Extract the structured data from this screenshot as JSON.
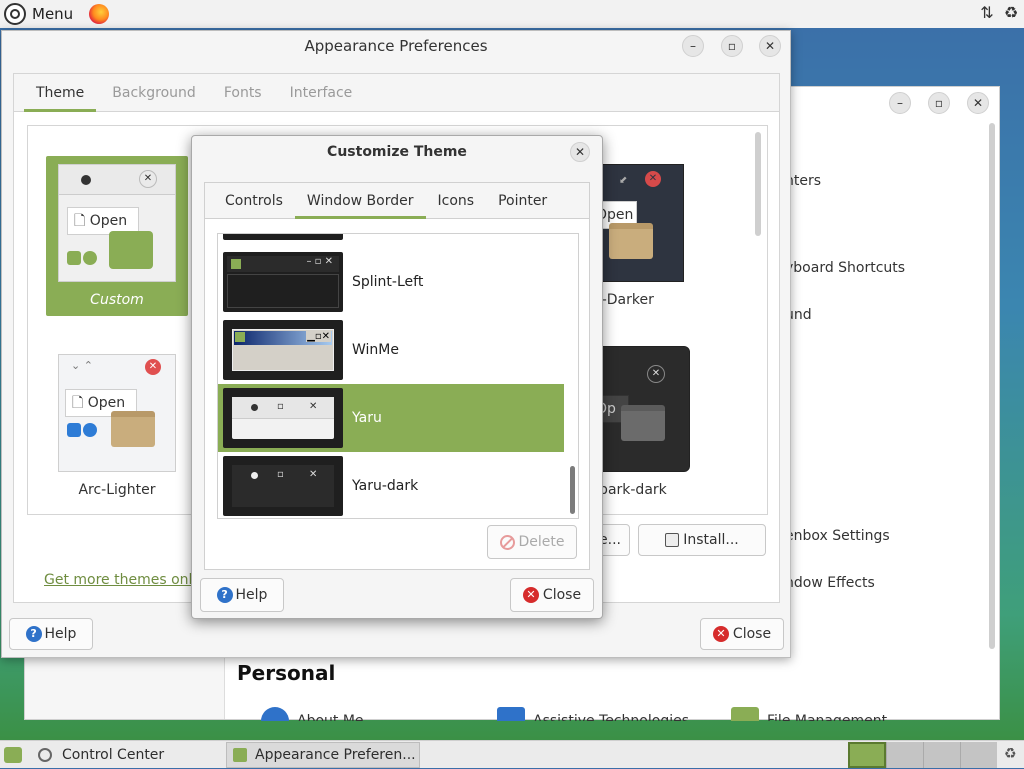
{
  "top_panel": {
    "menu_label": "Menu"
  },
  "control_center": {
    "items": [
      {
        "label": "Printers",
        "visible": "nters"
      },
      {
        "label": "Keyboard Shortcuts",
        "visible": "yboard Shortcuts"
      },
      {
        "label": "Sound",
        "visible": "und"
      },
      {
        "label": "Openbox Settings",
        "visible": "enbox Settings"
      },
      {
        "label": "Window Effects",
        "visible": "ndow Effects"
      }
    ],
    "section_title": "Personal",
    "bottom_items": [
      "About Me",
      "Assistive Technologies",
      "File Management"
    ]
  },
  "appearance": {
    "title": "Appearance Preferences",
    "tabs": [
      "Theme",
      "Background",
      "Fonts",
      "Interface"
    ],
    "themes": [
      {
        "label": "Custom",
        "open_label": "Open"
      },
      {
        "label": "Arc-Darker",
        "visible": "c-Darker",
        "open_label": "Open"
      },
      {
        "label": "Arc-Lighter",
        "open_label": "Open"
      },
      {
        "label": "bark-dark",
        "visible": "-bark-dark",
        "open_label": "Op"
      }
    ],
    "link": "Get more themes online",
    "customize_partial": "e...",
    "install_label": "Install...",
    "help_label": "Help",
    "close_label": "Close"
  },
  "customize": {
    "title": "Customize Theme",
    "tabs": [
      "Controls",
      "Window Border",
      "Icons",
      "Pointer"
    ],
    "active_tab": "Window Border",
    "rows": [
      {
        "label": "Splint-Left"
      },
      {
        "label": "WinMe"
      },
      {
        "label": "Yaru",
        "selected": true
      },
      {
        "label": "Yaru-dark"
      }
    ],
    "delete_label": "Delete",
    "help_label": "Help",
    "close_label": "Close"
  },
  "taskbar": {
    "items": [
      "Control Center",
      "Appearance Preferen..."
    ]
  },
  "colors": {
    "accent": "#8aad55",
    "link": "#6f8d40",
    "close": "#d62c2c",
    "help": "#2f72c9"
  }
}
